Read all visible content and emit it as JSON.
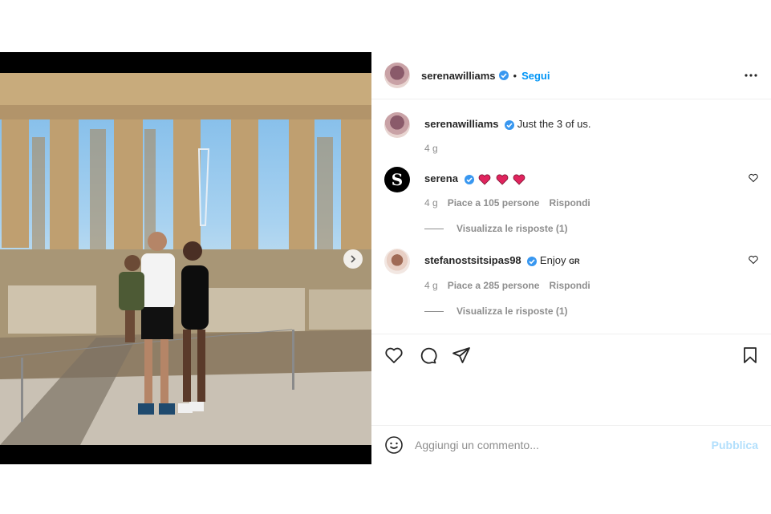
{
  "post": {
    "author": "serenawilliams",
    "follow_label": "Segui",
    "separator": "•",
    "caption": "Just the 3 of us.",
    "caption_time": "4 g",
    "slides_count": 2,
    "active_slide": 1
  },
  "comments": [
    {
      "user": "serena",
      "text": "",
      "emoji": [
        "heart-icon",
        "heart-icon",
        "heart-icon"
      ],
      "time": "4 g",
      "likes": "Piace a 105 persone",
      "reply_label": "Rispondi",
      "view_replies": "Visualizza le risposte (1)"
    },
    {
      "user": "stefanostsitsipas98",
      "text": "Enjoy",
      "flag": "GR",
      "time": "4 g",
      "likes": "Piace a 285 persone",
      "reply_label": "Rispondi",
      "view_replies": "Visualizza le risposte (1)"
    }
  ],
  "add_comment": {
    "placeholder": "Aggiungi un commento...",
    "publish_label": "Pubblica"
  },
  "colors": {
    "accent": "#0095f6",
    "publish_disabled": "#b2dffc",
    "verified": "#3897f0",
    "heart_red": "#e0245e"
  }
}
